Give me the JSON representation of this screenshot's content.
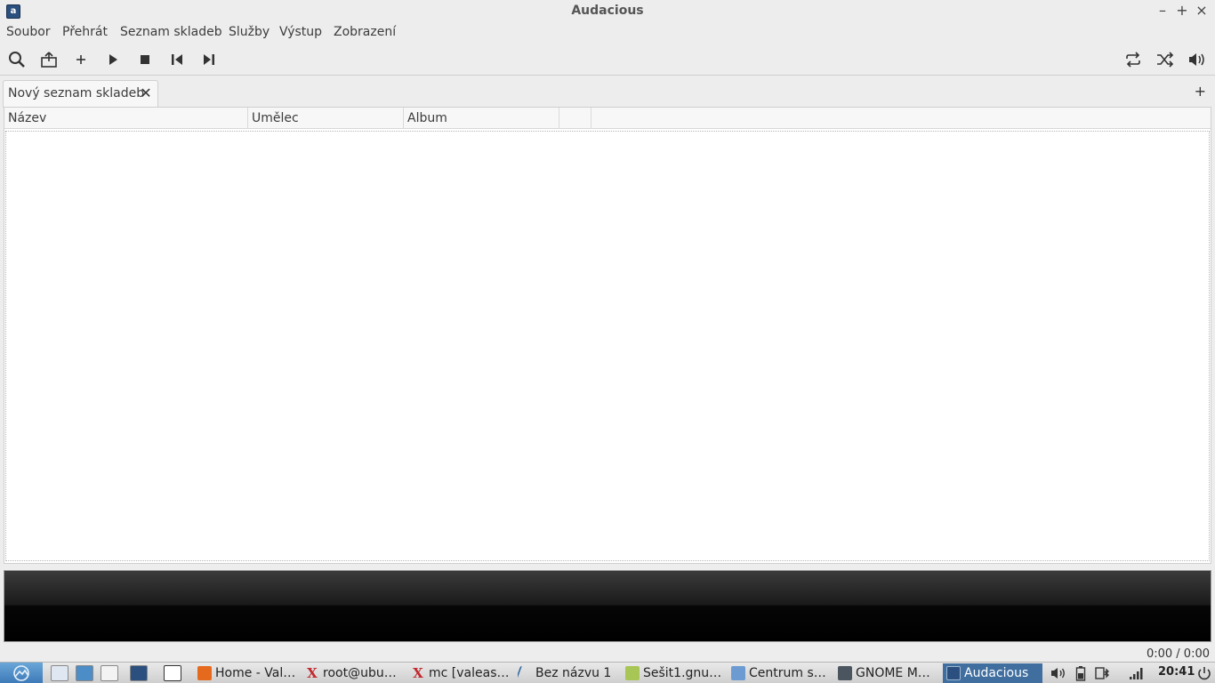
{
  "window": {
    "title": "Audacious",
    "app_icon_glyph": "a",
    "minimize_glyph": "–",
    "maximize_glyph": "+",
    "close_glyph": "×"
  },
  "menu": {
    "items": [
      "Soubor",
      "Přehrát",
      "Seznam skladeb",
      "Služby",
      "Výstup",
      "Zobrazení"
    ]
  },
  "toolbar": {
    "icons": [
      "search-icon",
      "open-icon",
      "add-icon",
      "play-icon",
      "stop-icon",
      "previous-icon",
      "next-icon",
      "repeat-icon",
      "shuffle-icon",
      "volume-icon"
    ]
  },
  "tabs": {
    "items": [
      {
        "label": "Nový seznam skladeb",
        "close_glyph": "✕"
      }
    ],
    "add_glyph": "+"
  },
  "playlist": {
    "columns": [
      "Název",
      "Umělec",
      "Album",
      ""
    ],
    "rows": []
  },
  "status": {
    "time": "0:00 / 0:00"
  },
  "taskbar": {
    "tasks": [
      "Home - Val…",
      "root@ubu…",
      "mc [valeas…",
      "Bez názvu 1",
      "Sešit1.gnu…",
      "Centrum s…",
      "GNOME M…",
      "Audacious"
    ],
    "clock": "20:41"
  },
  "colors": {
    "window_bg": "#ededed",
    "info_area": "#1a1a1a",
    "taskbar_active": "#3f6e9f",
    "start_button": "#3b78b6"
  }
}
